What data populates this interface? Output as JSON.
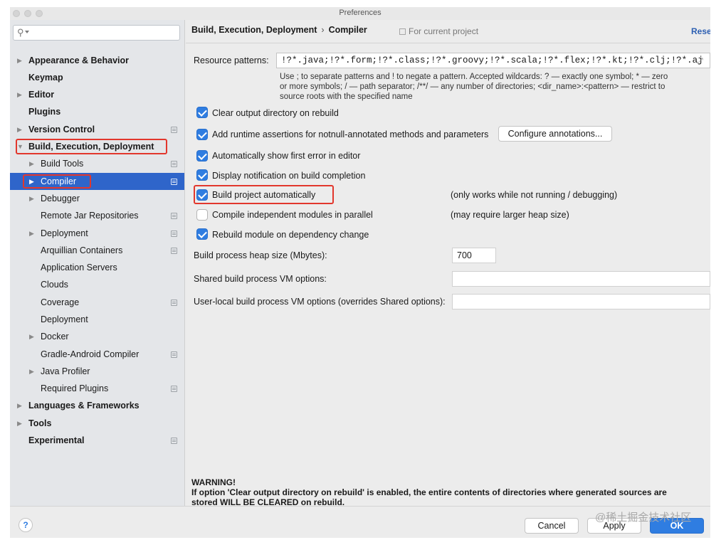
{
  "window": {
    "title": "Preferences"
  },
  "sidebar": {
    "search_placeholder": "",
    "items": [
      {
        "label": "Appearance & Behavior",
        "name": "sidebar-item-appearance-behavior"
      },
      {
        "label": "Keymap",
        "name": "sidebar-item-keymap"
      },
      {
        "label": "Editor",
        "name": "sidebar-item-editor"
      },
      {
        "label": "Plugins",
        "name": "sidebar-item-plugins"
      },
      {
        "label": "Version Control",
        "name": "sidebar-item-version-control"
      },
      {
        "label": "Build, Execution, Deployment",
        "name": "sidebar-item-build-execution-deployment"
      },
      {
        "label": "Build Tools",
        "name": "sidebar-item-build-tools"
      },
      {
        "label": "Compiler",
        "name": "sidebar-item-compiler"
      },
      {
        "label": "Debugger",
        "name": "sidebar-item-debugger"
      },
      {
        "label": "Remote Jar Repositories",
        "name": "sidebar-item-remote-jar-repositories"
      },
      {
        "label": "Deployment",
        "name": "sidebar-item-deployment"
      },
      {
        "label": "Arquillian Containers",
        "name": "sidebar-item-arquillian-containers"
      },
      {
        "label": "Application Servers",
        "name": "sidebar-item-application-servers"
      },
      {
        "label": "Clouds",
        "name": "sidebar-item-clouds"
      },
      {
        "label": "Coverage",
        "name": "sidebar-item-coverage"
      },
      {
        "label": "Deployment",
        "name": "sidebar-item-deployment-2"
      },
      {
        "label": "Docker",
        "name": "sidebar-item-docker"
      },
      {
        "label": "Gradle-Android Compiler",
        "name": "sidebar-item-gradle-android-compiler"
      },
      {
        "label": "Java Profiler",
        "name": "sidebar-item-java-profiler"
      },
      {
        "label": "Required Plugins",
        "name": "sidebar-item-required-plugins"
      },
      {
        "label": "Languages & Frameworks",
        "name": "sidebar-item-languages-frameworks"
      },
      {
        "label": "Tools",
        "name": "sidebar-item-tools"
      },
      {
        "label": "Experimental",
        "name": "sidebar-item-experimental"
      }
    ],
    "selected": "Compiler"
  },
  "header": {
    "breadcrumb_parent": "Build, Execution, Deployment",
    "breadcrumb_separator": "›",
    "breadcrumb_current": "Compiler",
    "for_current_project": "For current project",
    "reset_label": "Rese"
  },
  "compiler": {
    "resource_patterns_label": "Resource patterns:",
    "resource_patterns_value": "!?*.java;!?*.form;!?*.class;!?*.groovy;!?*.scala;!?*.flex;!?*.kt;!?*.clj;!?*.aj",
    "resource_hint_line1": "Use ; to separate patterns and ! to negate a pattern. Accepted wildcards: ? — exactly one symbol; * — zero",
    "resource_hint_line2": "or more symbols; / — path separator; /**/ — any number of directories; <dir_name>:<pattern> — restrict to",
    "resource_hint_line3": "source roots with the specified name",
    "options": [
      {
        "label": "Clear output directory on rebuild",
        "checked": true
      },
      {
        "label": "Add runtime assertions for notnull-annotated methods and parameters",
        "checked": true
      },
      {
        "label": "Automatically show first error in editor",
        "checked": true
      },
      {
        "label": "Display notification on build completion",
        "checked": true
      },
      {
        "label": "Build project automatically",
        "checked": true
      },
      {
        "label": "Compile independent modules in parallel",
        "checked": false
      },
      {
        "label": "Rebuild module on dependency change",
        "checked": true
      }
    ],
    "configure_annotations_label": "Configure annotations...",
    "build_auto_note": "(only works while not running / debugging)",
    "parallel_note": "(may require larger heap size)",
    "heap_size_label": "Build process heap size (Mbytes):",
    "heap_size_value": "700",
    "shared_vm_label": "Shared build process VM options:",
    "shared_vm_value": "",
    "user_vm_label": "User-local build process VM options (overrides Shared options):",
    "user_vm_value": "",
    "warning_title": "WARNING!",
    "warning_line1": "If option 'Clear output directory on rebuild' is enabled, the entire contents of directories where generated sources are",
    "warning_line2": "stored WILL BE CLEARED on rebuild."
  },
  "footer": {
    "help_label": "?",
    "cancel_label": "Cancel",
    "apply_label": "Apply",
    "ok_label": "OK",
    "watermark": "@稀土掘金技术社区"
  },
  "colors": {
    "accent": "#2f7de1",
    "selection": "#2f65ca",
    "highlight": "#e2372d"
  }
}
